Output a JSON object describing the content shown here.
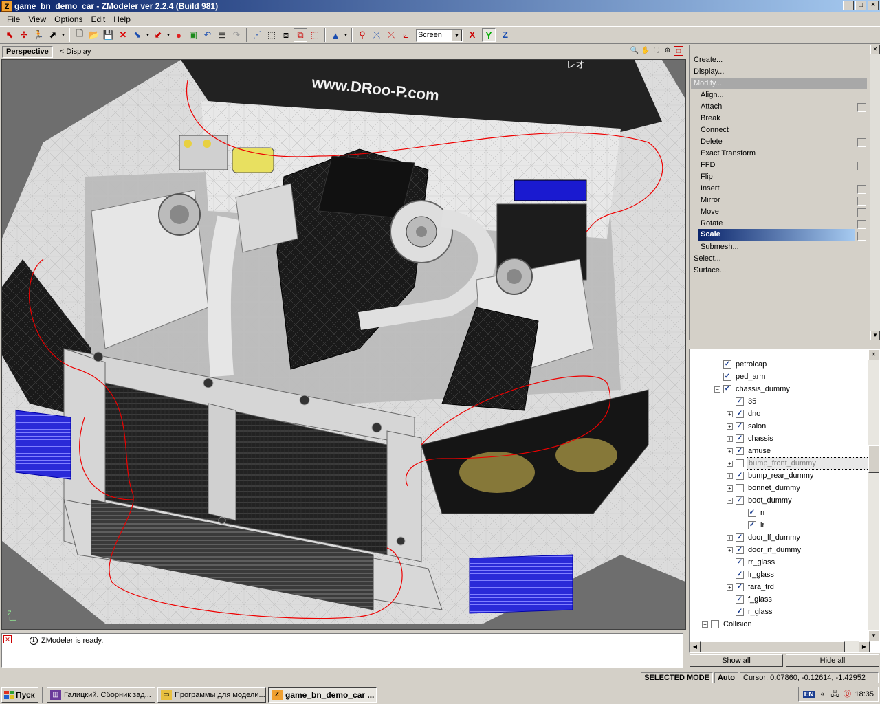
{
  "window": {
    "title": "game_bn_demo_car - ZModeler ver 2.2.4 (Build 981)",
    "app_icon": "Z",
    "icons": [
      "minimize-icon",
      "maximize-icon",
      "close-icon"
    ]
  },
  "menu": [
    {
      "label": "File"
    },
    {
      "label": "View"
    },
    {
      "label": "Options"
    },
    {
      "label": "Edit"
    },
    {
      "label": "Help"
    }
  ],
  "toolbar": {
    "coord_mode": "Screen",
    "axes": [
      "X",
      "Y",
      "Z"
    ]
  },
  "viewport": {
    "tab": "Perspective",
    "display_link": "< Display",
    "watermark": "www.DRoo-P.com",
    "decal": "レオ",
    "axis_label": "Z"
  },
  "commands": [
    {
      "label": "Create...",
      "level": 0
    },
    {
      "label": "Display...",
      "level": 0
    },
    {
      "label": "Modify...",
      "level": 0,
      "state": "expanded"
    },
    {
      "label": "Align...",
      "level": 1
    },
    {
      "label": "Attach",
      "level": 1,
      "box": true
    },
    {
      "label": "Break",
      "level": 1
    },
    {
      "label": "Connect",
      "level": 1
    },
    {
      "label": "Delete",
      "level": 1,
      "box": true
    },
    {
      "label": "Exact Transform",
      "level": 1
    },
    {
      "label": "FFD",
      "level": 1,
      "box": true
    },
    {
      "label": "Flip",
      "level": 1
    },
    {
      "label": "Insert",
      "level": 1,
      "box": true
    },
    {
      "label": "Mirror",
      "level": 1,
      "box": true
    },
    {
      "label": "Move",
      "level": 1,
      "box": true
    },
    {
      "label": "Rotate",
      "level": 1,
      "box": true
    },
    {
      "label": "Scale",
      "level": 1,
      "box": true,
      "state": "selected"
    },
    {
      "label": "Submesh...",
      "level": 1
    },
    {
      "label": "Select...",
      "level": 0
    },
    {
      "label": "Surface...",
      "level": 0
    }
  ],
  "tree": [
    {
      "label": "petrolcap",
      "indent": 1,
      "checked": true,
      "expander": ""
    },
    {
      "label": "ped_arm",
      "indent": 1,
      "checked": true,
      "expander": ""
    },
    {
      "label": "chassis_dummy",
      "indent": 1,
      "checked": true,
      "expander": "−"
    },
    {
      "label": "35",
      "indent": 2,
      "checked": true,
      "expander": ""
    },
    {
      "label": "dno",
      "indent": 2,
      "checked": true,
      "expander": "+"
    },
    {
      "label": "salon",
      "indent": 2,
      "checked": true,
      "expander": "+"
    },
    {
      "label": "chassis",
      "indent": 2,
      "checked": true,
      "expander": "+"
    },
    {
      "label": "amuse",
      "indent": 2,
      "checked": true,
      "expander": "+"
    },
    {
      "label": "bump_front_dummy",
      "indent": 2,
      "checked": false,
      "expander": "+",
      "selected": true
    },
    {
      "label": "bump_rear_dummy",
      "indent": 2,
      "checked": true,
      "expander": "+"
    },
    {
      "label": "bonnet_dummy",
      "indent": 2,
      "checked": false,
      "expander": "+"
    },
    {
      "label": "boot_dummy",
      "indent": 2,
      "checked": true,
      "expander": "−"
    },
    {
      "label": "rr",
      "indent": 3,
      "checked": true,
      "expander": ""
    },
    {
      "label": "lr",
      "indent": 3,
      "checked": true,
      "expander": ""
    },
    {
      "label": "door_lf_dummy",
      "indent": 2,
      "checked": true,
      "expander": "+"
    },
    {
      "label": "door_rf_dummy",
      "indent": 2,
      "checked": true,
      "expander": "+"
    },
    {
      "label": "rr_glass",
      "indent": 2,
      "checked": true,
      "expander": ""
    },
    {
      "label": "lr_glass",
      "indent": 2,
      "checked": true,
      "expander": ""
    },
    {
      "label": "fara_trd",
      "indent": 2,
      "checked": true,
      "expander": "+"
    },
    {
      "label": "f_glass",
      "indent": 2,
      "checked": true,
      "expander": ""
    },
    {
      "label": "r_glass",
      "indent": 2,
      "checked": true,
      "expander": ""
    },
    {
      "label": "Collision",
      "indent": 0,
      "checked": false,
      "expander": "+"
    }
  ],
  "tree_buttons": {
    "show_all": "Show all",
    "hide_all": "Hide all"
  },
  "log": {
    "message": "ZModeler is ready."
  },
  "status": {
    "mode": "SELECTED MODE",
    "snap": "Auto",
    "cursor": "Cursor: 0.07860, -0.12614, -1.42952"
  },
  "taskbar": {
    "start": "Пуск",
    "tasks": [
      {
        "label": "Галицкий. Сборник зад...",
        "icon": "book-icon",
        "active": false
      },
      {
        "label": "Программы для модели...",
        "icon": "folder-icon",
        "active": false
      },
      {
        "label": "game_bn_demo_car ...",
        "icon": "zmodeler-icon",
        "active": true
      }
    ],
    "lang": "EN",
    "clock": "18:35"
  }
}
